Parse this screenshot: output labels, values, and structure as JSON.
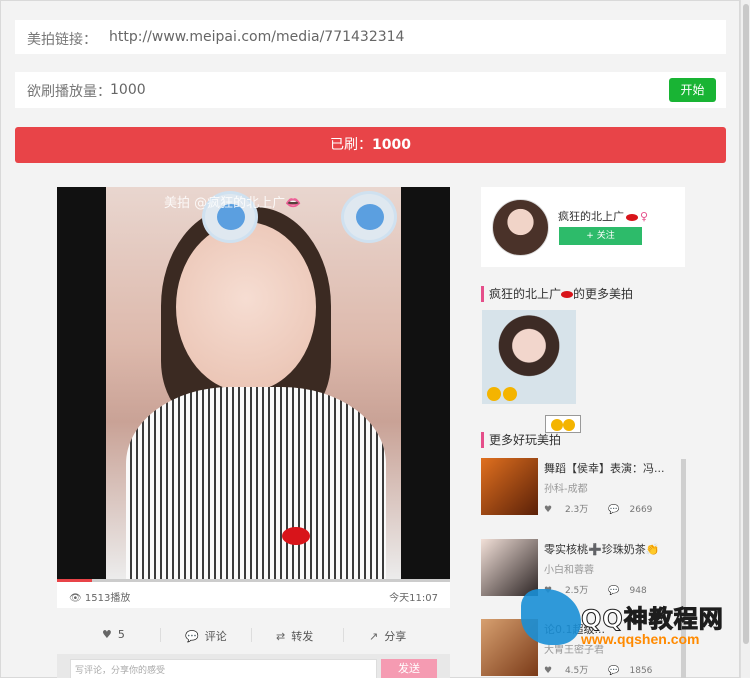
{
  "url_row": {
    "label": "美拍链接：",
    "value": "http://www.meipai.com/media/771432314"
  },
  "plays_row": {
    "label": "欲刷播放量：",
    "value": "1000",
    "start_label": "开始"
  },
  "status_bar": {
    "prefix": "已刷：",
    "count": "1000"
  },
  "video": {
    "caption": "美拍 @疯狂的北上广👄",
    "views": "1513播放",
    "time": "今天11:07",
    "likes": "5",
    "comment_label": "评论",
    "repost_label": "转发",
    "share_label": "分享",
    "comment_placeholder": "写评论，分享你的感受",
    "send_label": "发送"
  },
  "profile": {
    "name": "疯狂的北上广",
    "follow_label": "+ 关注"
  },
  "more_section": {
    "title_prefix": "疯狂的北上广",
    "title_suffix": "的更多美拍"
  },
  "fun_section": {
    "title": "更多好玩美拍"
  },
  "items": [
    {
      "title": "舞蹈【侯幸】表演：冯...",
      "user": "孙科-成都",
      "likes": "2.3万",
      "comments": "2669",
      "color": "#c0521f"
    },
    {
      "title": "零实核桃➕珍珠奶茶👏",
      "user": "小白和蓉蓉",
      "likes": "2.5万",
      "comments": "948",
      "color": "#c8a090"
    },
    {
      "title": "论0.1超级...",
      "user": "大胃王密子君",
      "likes": "4.5万",
      "comments": "1856",
      "color": "#b07040"
    }
  ],
  "watermark": {
    "brand": "QQ神教程网",
    "site": "www.qqshen.com"
  },
  "colors": {
    "accent_red": "#e84448",
    "green": "#19b434",
    "pink": "#e54e8a"
  }
}
